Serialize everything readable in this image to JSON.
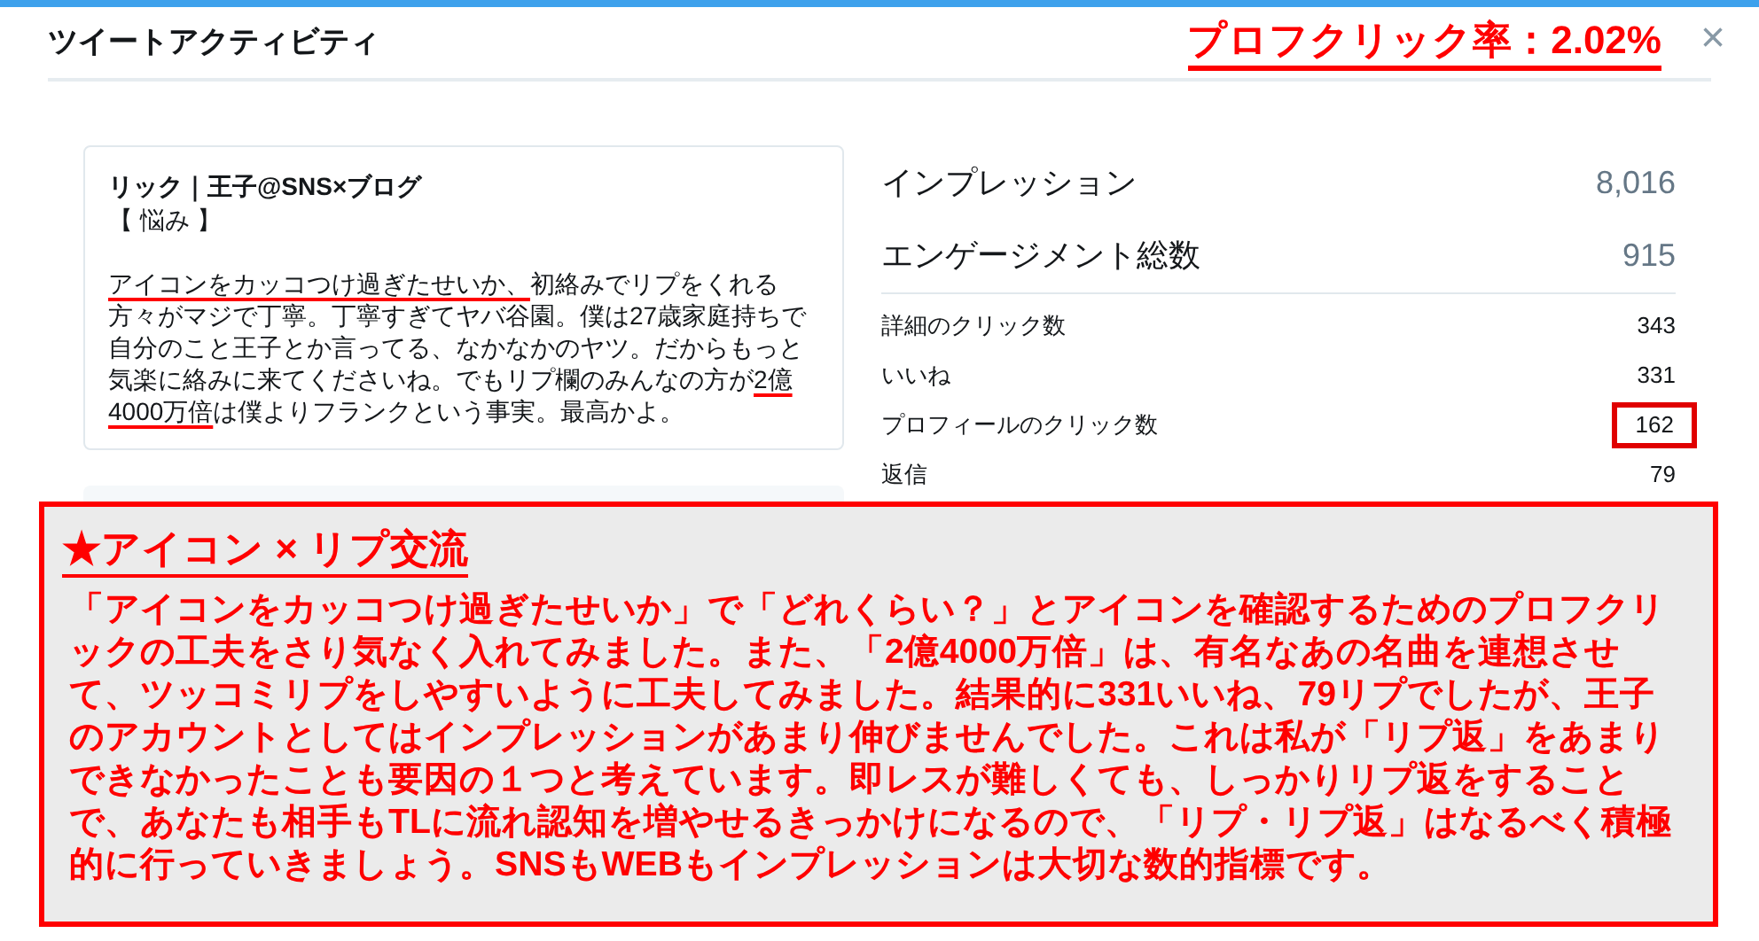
{
  "header": {
    "title": "ツイートアクティビティ",
    "annotation": "プロフクリック率：2.02%",
    "close": "×"
  },
  "tweet": {
    "author": "リック｜王子@SNS×ブログ",
    "tag": "【 悩み 】",
    "segments": [
      {
        "text": "アイコンをカッコつけ過ぎたせいか、",
        "underlined": true
      },
      {
        "text": "初絡みでリプをくれる方々がマジで丁寧。丁寧すぎてヤバ谷園。僕は27歳家庭持ちで自分のこと王子とか言ってる、なかなかのヤツ。だからもっと気楽に絡みに来てくださいね。でもリプ欄のみんなの方が",
        "underlined": false
      },
      {
        "text": "2億4000万倍",
        "underlined": true
      },
      {
        "text": "は僕よりフランクという事実。最高かよ。",
        "underlined": false
      }
    ]
  },
  "totals": [
    {
      "label": "インプレッション",
      "value": "8,016"
    },
    {
      "label": "エンゲージメント総数",
      "value": "915"
    }
  ],
  "details": [
    {
      "label": "詳細のクリック数",
      "value": "343",
      "highlighted": false
    },
    {
      "label": "いいね",
      "value": "331",
      "highlighted": false
    },
    {
      "label": "プロフィールのクリック数",
      "value": "162",
      "highlighted": true
    },
    {
      "label": "返信",
      "value": "79",
      "highlighted": false
    }
  ],
  "note": {
    "heading": "★アイコン × リプ交流",
    "body": "「アイコンをカッコつけ過ぎたせいか」で「どれくらい？」とアイコンを確認するためのプロフクリックの工夫をさり気なく入れてみました。また、「2億4000万倍」は、有名なあの名曲を連想させて、ツッコミリプをしやすいように工夫してみました。結果的に331いいね、79リプでしたが、王子のアカウントとしてはインプレッションがあまり伸びませんでした。これは私が「リプ返」をあまりできなかったことも要因の１つと考えています。即レスが難しくても、しっかりリプ返をすることで、あなたも相手もTLに流れ認知を増やせるきっかけになるので、「リプ・リプ返」はなるべく積極的に行っていきましょう。SNSもWEBもインプレッションは大切な数的指標です。"
  }
}
